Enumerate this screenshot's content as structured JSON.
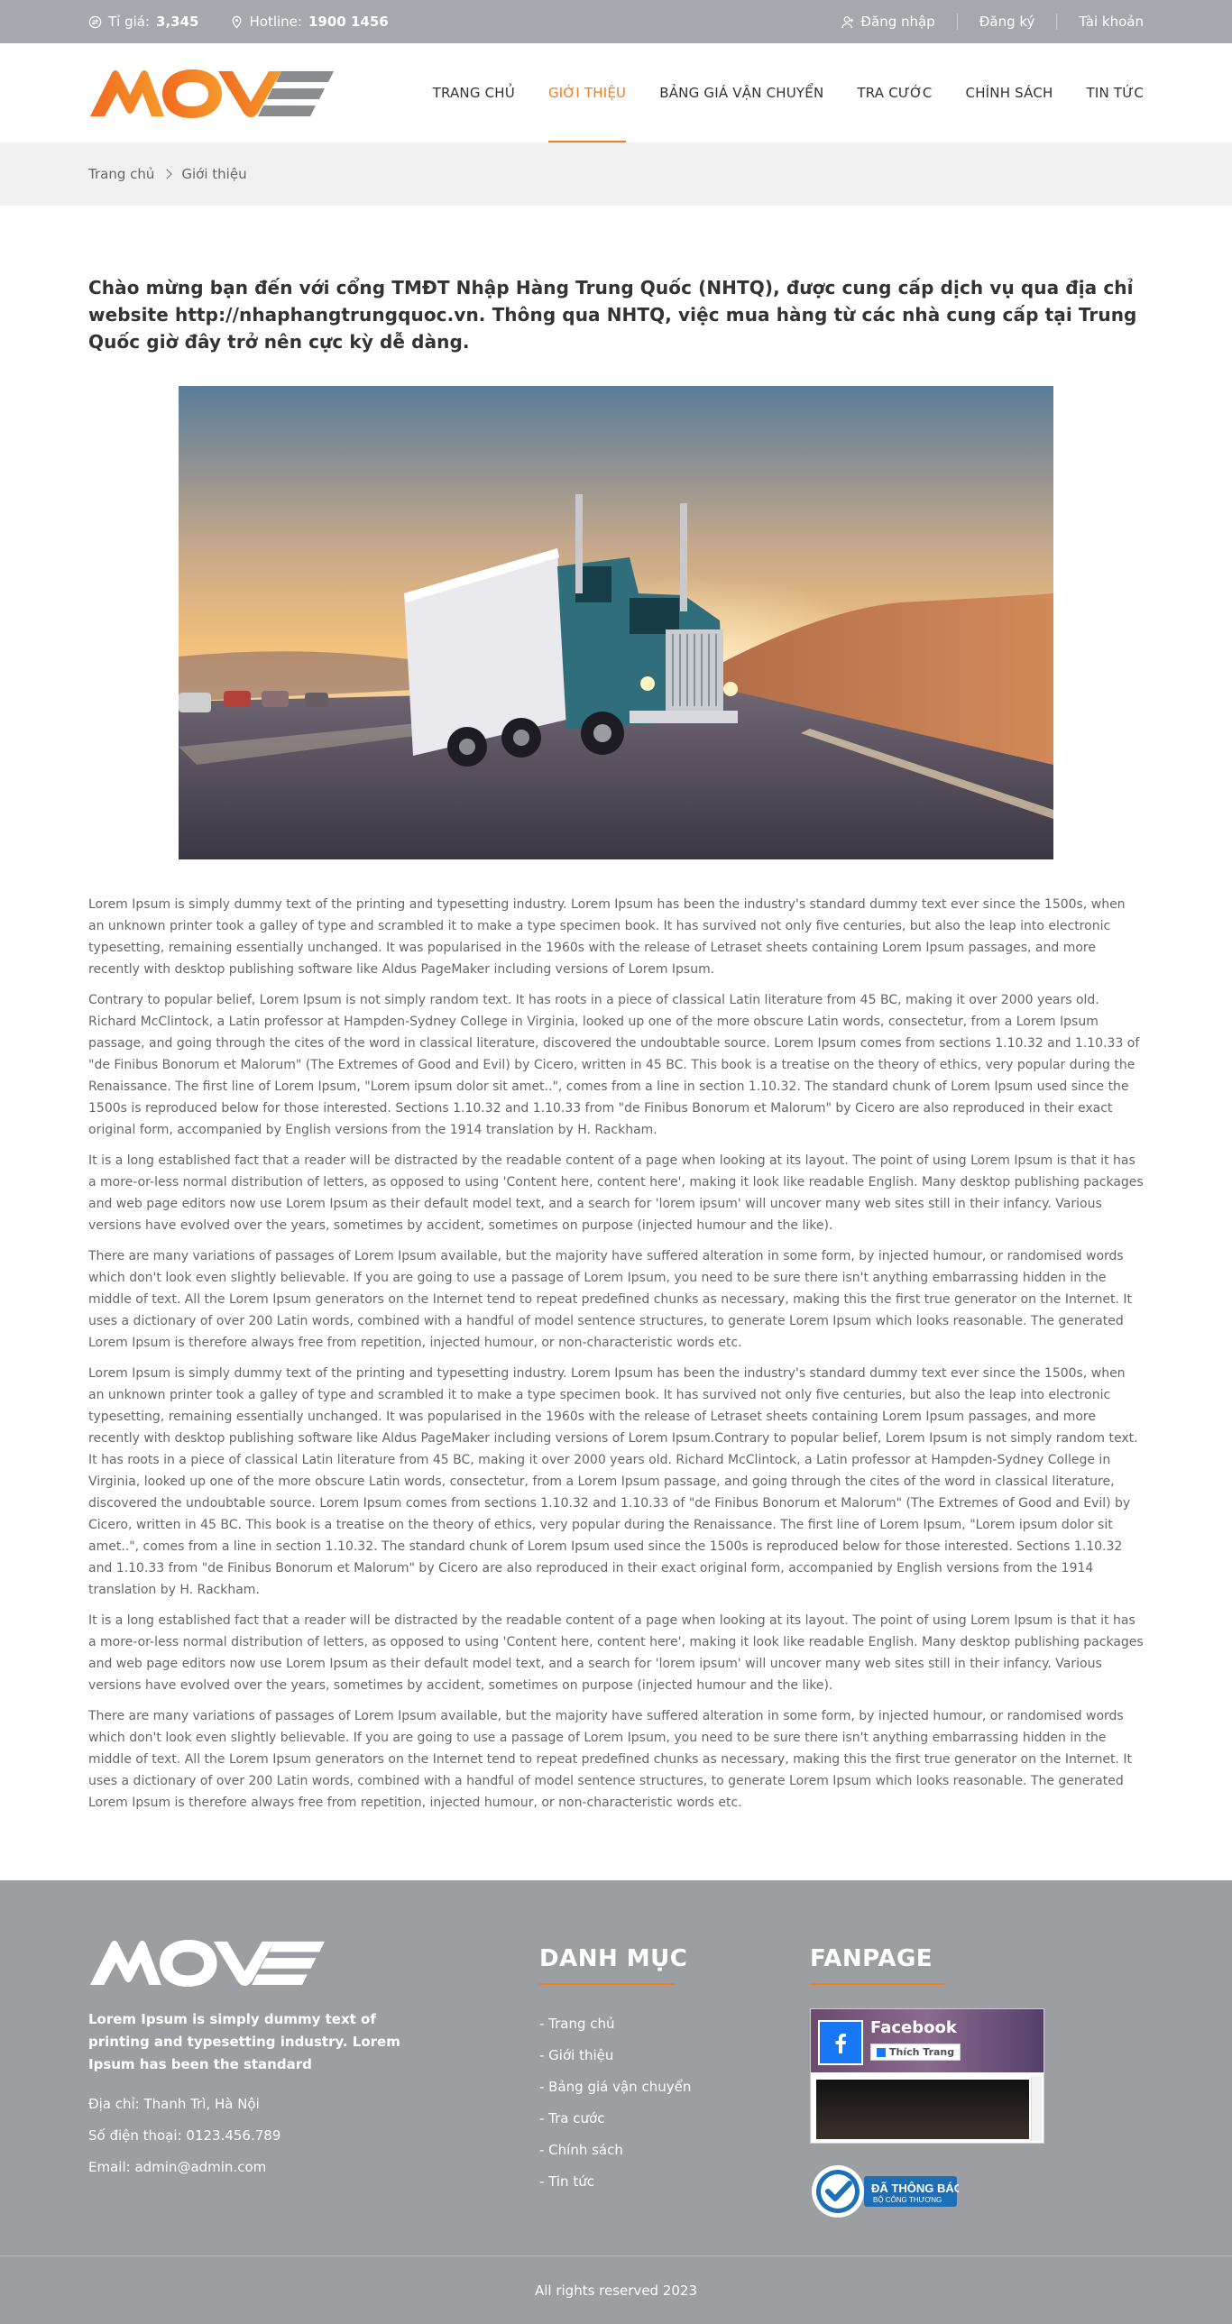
{
  "topbar": {
    "rate_label": "Tỉ giá:",
    "rate_value": "3,345",
    "hotline_label": "Hotline:",
    "hotline_value": "1900 1456",
    "login": "Đăng nhập",
    "register": "Đăng ký",
    "account": "Tài khoản"
  },
  "header": {
    "logo_text": "MOVE",
    "nav": [
      {
        "label": "TRANG CHỦ",
        "active": false
      },
      {
        "label": "GIỚI THIỆU",
        "active": true
      },
      {
        "label": "BẢNG GIÁ VẬN CHUYỂN",
        "active": false
      },
      {
        "label": "TRA CƯỚC",
        "active": false
      },
      {
        "label": "CHÍNH SÁCH",
        "active": false
      },
      {
        "label": "TIN TỨC",
        "active": false
      }
    ]
  },
  "breadcrumb": {
    "home": "Trang chủ",
    "current": "Giới thiệu"
  },
  "main": {
    "intro": "Chào mừng bạn đến với cổng TMĐT Nhập Hàng Trung Quốc (NHTQ), được cung cấp dịch vụ qua địa chỉ website http://nhaphangtrungquoc.vn. Thông qua NHTQ, việc mua hàng từ các nhà cung cấp tại Trung Quốc giờ đây trở nên cực kỳ dễ dàng.",
    "paragraphs": [
      "Lorem Ipsum is simply dummy text of the printing and typesetting industry. Lorem Ipsum has been the industry's standard dummy text ever since the 1500s, when an unknown printer took a galley of type and scrambled it to make a type specimen book. It has survived not only five centuries, but also the leap into electronic typesetting, remaining essentially unchanged. It was popularised in the 1960s with the release of Letraset sheets containing Lorem Ipsum passages, and more recently with desktop publishing software like Aldus PageMaker including versions of Lorem Ipsum.",
      "Contrary to popular belief, Lorem Ipsum is not simply random text. It has roots in a piece of classical Latin literature from 45 BC, making it over 2000 years old. Richard McClintock, a Latin professor at Hampden-Sydney College in Virginia, looked up one of the more obscure Latin words, consectetur, from a Lorem Ipsum passage, and going through the cites of the word in classical literature, discovered the undoubtable source. Lorem Ipsum comes from sections 1.10.32 and 1.10.33 of \"de Finibus Bonorum et Malorum\" (The Extremes of Good and Evil) by Cicero, written in 45 BC. This book is a treatise on the theory of ethics, very popular during the Renaissance. The first line of Lorem Ipsum, \"Lorem ipsum dolor sit amet..\", comes from a line in section 1.10.32. The standard chunk of Lorem Ipsum used since the 1500s is reproduced below for those interested. Sections 1.10.32 and 1.10.33 from \"de Finibus Bonorum et Malorum\" by Cicero are also reproduced in their exact original form, accompanied by English versions from the 1914 translation by H. Rackham.",
      "It is a long established fact that a reader will be distracted by the readable content of a page when looking at its layout. The point of using Lorem Ipsum is that it has a more-or-less normal distribution of letters, as opposed to using 'Content here, content here', making it look like readable English. Many desktop publishing packages and web page editors now use Lorem Ipsum as their default model text, and a search for 'lorem ipsum' will uncover many web sites still in their infancy. Various versions have evolved over the years, sometimes by accident, sometimes on purpose (injected humour and the like).",
      "There are many variations of passages of Lorem Ipsum available, but the majority have suffered alteration in some form, by injected humour, or randomised words which don't look even slightly believable. If you are going to use a passage of Lorem Ipsum, you need to be sure there isn't anything embarrassing hidden in the middle of text. All the Lorem Ipsum generators on the Internet tend to repeat predefined chunks as necessary, making this the first true generator on the Internet. It uses a dictionary of over 200 Latin words, combined with a handful of model sentence structures, to generate Lorem Ipsum which looks reasonable. The generated Lorem Ipsum is therefore always free from repetition, injected humour, or non-characteristic words etc.",
      "Lorem Ipsum is simply dummy text of the printing and typesetting industry. Lorem Ipsum has been the industry's standard dummy text ever since the 1500s, when an unknown printer took a galley of type and scrambled it to make a type specimen book. It has survived not only five centuries, but also the leap into electronic typesetting, remaining essentially unchanged. It was popularised in the 1960s with the release of Letraset sheets containing Lorem Ipsum passages, and more recently with desktop publishing software like Aldus PageMaker including versions of Lorem Ipsum.Contrary to popular belief, Lorem Ipsum is not simply random text. It has roots in a piece of classical Latin literature from 45 BC, making it over 2000 years old. Richard McClintock, a Latin professor at Hampden-Sydney College in Virginia, looked up one of the more obscure Latin words, consectetur, from a Lorem Ipsum passage, and going through the cites of the word in classical literature, discovered the undoubtable source. Lorem Ipsum comes from sections 1.10.32 and 1.10.33 of \"de Finibus Bonorum et Malorum\" (The Extremes of Good and Evil) by Cicero, written in 45 BC. This book is a treatise on the theory of ethics, very popular during the Renaissance. The first line of Lorem Ipsum, \"Lorem ipsum dolor sit amet..\", comes from a line in section 1.10.32. The standard chunk of Lorem Ipsum used since the 1500s is reproduced below for those interested. Sections 1.10.32 and 1.10.33 from \"de Finibus Bonorum et Malorum\" by Cicero are also reproduced in their exact original form, accompanied by English versions from the 1914 translation by H. Rackham.",
      "It is a long established fact that a reader will be distracted by the readable content of a page when looking at its layout. The point of using Lorem Ipsum is that it has a more-or-less normal distribution of letters, as opposed to using 'Content here, content here', making it look like readable English. Many desktop publishing packages and web page editors now use Lorem Ipsum as their default model text, and a search for 'lorem ipsum' will uncover many web sites still in their infancy. Various versions have evolved over the years, sometimes by accident, sometimes on purpose (injected humour and the like).",
      "There are many variations of passages of Lorem Ipsum available, but the majority have suffered alteration in some form, by injected humour, or randomised words which don't look even slightly believable. If you are going to use a passage of Lorem Ipsum, you need to be sure there isn't anything embarrassing hidden in the middle of text. All the Lorem Ipsum generators on the Internet tend to repeat predefined chunks as necessary, making this the first true generator on the Internet. It uses a dictionary of over 200 Latin words, combined with a handful of model sentence structures, to generate Lorem Ipsum which looks reasonable. The generated Lorem Ipsum is therefore always free from repetition, injected humour, or non-characteristic words etc."
    ]
  },
  "footer": {
    "logo_text": "MOVE",
    "description": "Lorem Ipsum is simply dummy text of printing and typesetting industry. Lorem Ipsum has been the standard",
    "address": "Địa chỉ: Thanh Trì, Hà Nội",
    "phone": "Số điện thoại: 0123.456.789",
    "email": "Email: admin@admin.com",
    "menu_title": "DANH MỤC",
    "menu": [
      "- Trang chủ",
      "- Giới thiệu",
      "- Bảng giá vận chuyển",
      "- Tra cước",
      "- Chính sách",
      "- Tin tức"
    ],
    "fanpage_title": "FANPAGE",
    "fb_name": "Facebook",
    "fb_like": "Thích Trang",
    "badge_title": "ĐÃ THÔNG BÁO",
    "badge_sub": "BỘ CÔNG THƯƠNG",
    "copyright": "All rights reserved 2023"
  },
  "colors": {
    "accent": "#f07d1e",
    "topbar_bg": "#a6a8ad",
    "footer_bg": "#9d9ea2",
    "breadcrumb_bg": "#f1f1f1"
  }
}
